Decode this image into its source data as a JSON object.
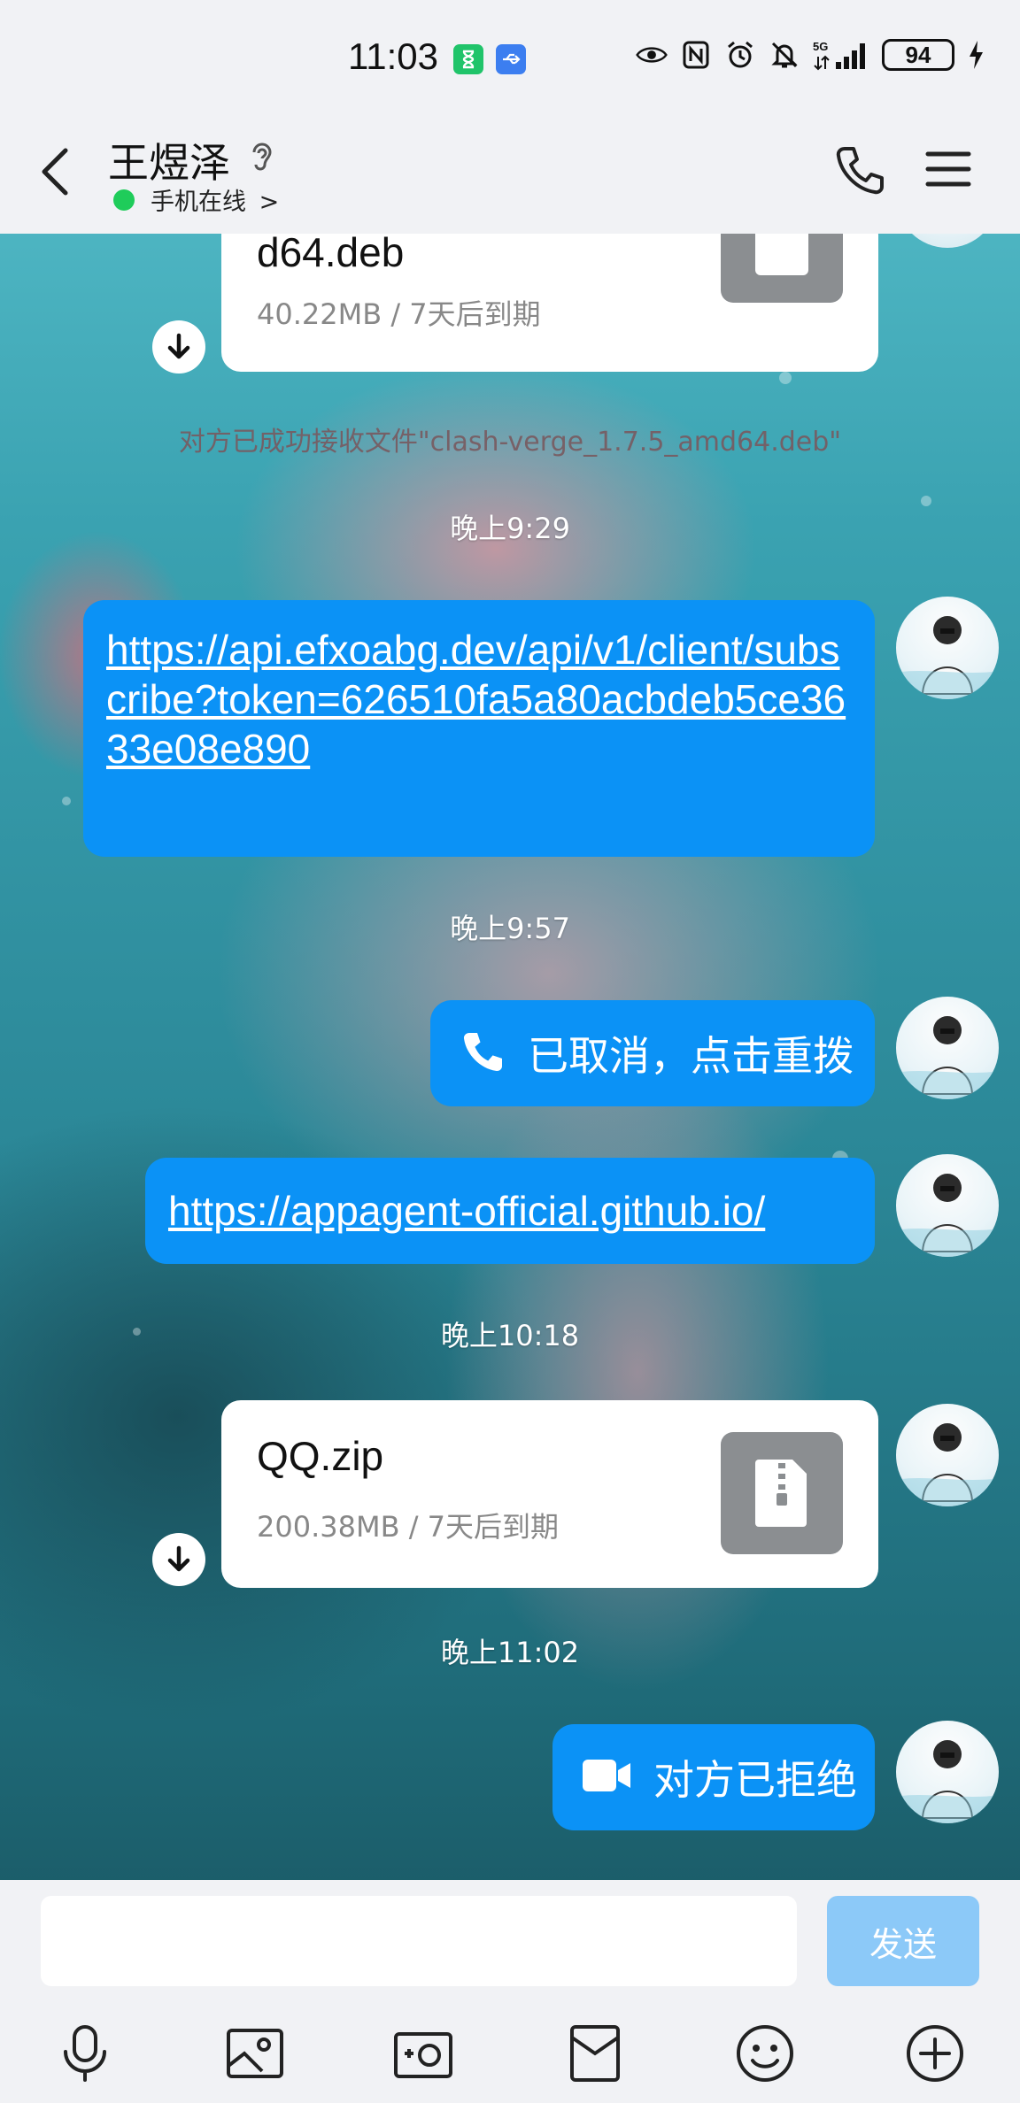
{
  "status_bar": {
    "time": "11:03",
    "network": "5G",
    "battery": "94"
  },
  "header": {
    "contact_name": "王煜泽",
    "online_status": "手机在线",
    "chevron": ">"
  },
  "messages": {
    "file1": {
      "name": "d64.deb",
      "meta": "40.22MB / 7天后到期"
    },
    "system_note": "对方已成功接收文件\"clash-verge_1.7.5_amd64.deb\"",
    "time1": "晚上9:29",
    "link1": "https://api.efxoabg.dev/api/v1/client/subscribe?token=626510fa5a80acbdeb5ce3633e08e890",
    "time2": "晚上9:57",
    "call_cancel": "已取消，点击重拨",
    "link2": "https://appagent-official.github.io/",
    "time3": "晚上10:18",
    "file2": {
      "name": "QQ.zip",
      "meta": "200.38MB / 7天后到期"
    },
    "time4": "晚上11:02",
    "video_rejected": "对方已拒绝"
  },
  "input": {
    "placeholder": "",
    "send_label": "发送"
  },
  "toolbar_icons": [
    "microphone-icon",
    "image-icon",
    "camera-icon",
    "red-packet-icon",
    "emoji-icon",
    "plus-icon"
  ],
  "colors": {
    "bubble_blue": "#0b92f6",
    "send_disabled": "#8cc9f8",
    "online_green": "#1fcc5a"
  }
}
